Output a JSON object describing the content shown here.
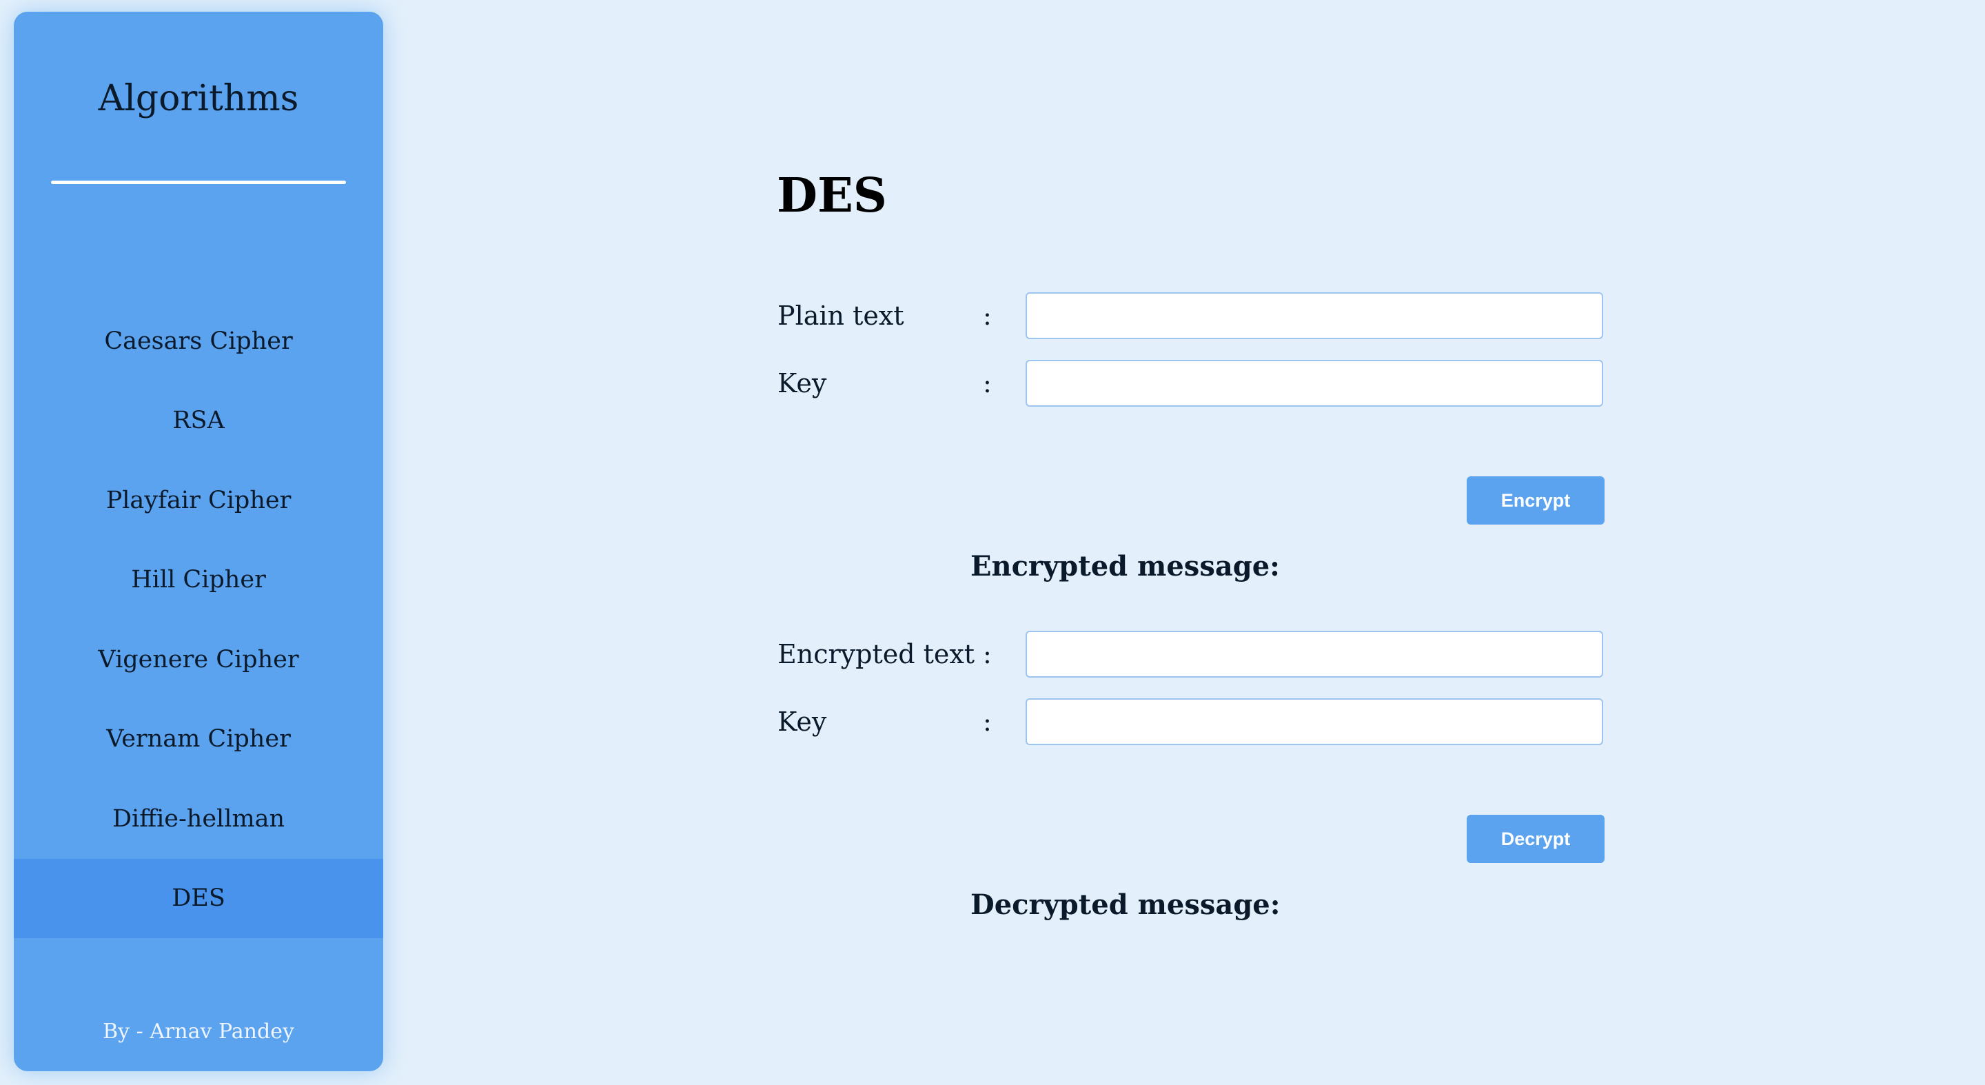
{
  "sidebar": {
    "title": "Algorithms",
    "items": [
      {
        "label": "Caesars Cipher"
      },
      {
        "label": "RSA"
      },
      {
        "label": "Playfair Cipher"
      },
      {
        "label": "Hill Cipher"
      },
      {
        "label": "Vigenere Cipher"
      },
      {
        "label": "Vernam Cipher"
      },
      {
        "label": "Diffie-hellman"
      },
      {
        "label": "DES"
      }
    ],
    "active_item": "DES",
    "footer": "By - Arnav Pandey"
  },
  "main": {
    "title": "DES",
    "encrypt_form": {
      "plain_text_label": "Plain text",
      "plain_text_value": "",
      "key_label": "Key",
      "key_value": "",
      "colon": ":",
      "button_label": "Encrypt",
      "result_label": "Encrypted message:"
    },
    "decrypt_form": {
      "encrypted_text_label": "Encrypted text",
      "encrypted_text_value": "",
      "key_label": "Key",
      "key_value": "",
      "colon": ":",
      "button_label": "Decrypt",
      "result_label": "Decrypted message:"
    }
  },
  "colors": {
    "background": "#e3f0fb",
    "sidebar": "#5ba3ef",
    "sidebar_active": "#4993ec",
    "button": "#5ba3ef"
  }
}
